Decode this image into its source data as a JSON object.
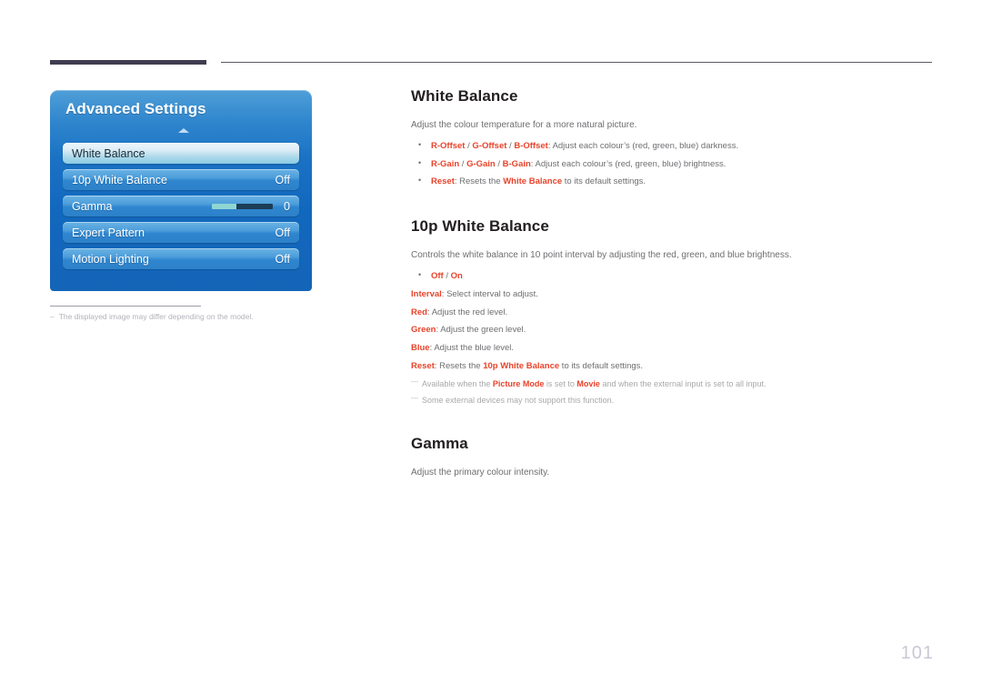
{
  "page": {
    "number": "101",
    "accent_color": "#e8432b",
    "body_color": "#6d6e71",
    "heading_color": "#231f20",
    "note_color": "#a7a9ac"
  },
  "osd": {
    "title": "Advanced Settings",
    "scroll_indicator": "up-arrow",
    "rows": [
      {
        "label": "White Balance",
        "value": "",
        "selected": true,
        "type": "item"
      },
      {
        "label": "10p White Balance",
        "value": "Off",
        "selected": false,
        "type": "item"
      },
      {
        "label": "Gamma",
        "value": "0",
        "selected": false,
        "type": "slider",
        "fill_percent": 40
      },
      {
        "label": "Expert Pattern",
        "value": "Off",
        "selected": false,
        "type": "item"
      },
      {
        "label": "Motion Lighting",
        "value": "Off",
        "selected": false,
        "type": "item"
      }
    ]
  },
  "left_note": {
    "dash": "–",
    "text": "The displayed image may differ depending on the model."
  },
  "sections": [
    {
      "title": "White Balance",
      "lead": "Adjust the colour temperature for a more natural picture.",
      "bullets": [
        {
          "parts": [
            {
              "t": "R-Offset",
              "s": "acc"
            },
            {
              "t": " / ",
              "s": "sep"
            },
            {
              "t": "G-Offset",
              "s": "acc"
            },
            {
              "t": " / ",
              "s": "sep"
            },
            {
              "t": "B-Offset",
              "s": "acc"
            },
            {
              "t": ": Adjust each colour’s (red, green, blue) darkness.",
              "s": "plain"
            }
          ]
        },
        {
          "parts": [
            {
              "t": "R-Gain",
              "s": "acc"
            },
            {
              "t": " / ",
              "s": "sep"
            },
            {
              "t": "G-Gain",
              "s": "acc"
            },
            {
              "t": " / ",
              "s": "sep"
            },
            {
              "t": "B-Gain",
              "s": "acc"
            },
            {
              "t": ": Adjust each colour’s (red, green, blue) brightness.",
              "s": "plain"
            }
          ]
        },
        {
          "parts": [
            {
              "t": "Reset",
              "s": "acc"
            },
            {
              "t": ": Resets the ",
              "s": "plain"
            },
            {
              "t": "White Balance",
              "s": "acc"
            },
            {
              "t": " to its default settings.",
              "s": "plain"
            }
          ]
        }
      ],
      "deflines": [],
      "notes": []
    },
    {
      "title": "10p White Balance",
      "lead": "Controls the white balance in 10 point interval by adjusting the red, green, and blue brightness.",
      "bullets": [
        {
          "parts": [
            {
              "t": "Off",
              "s": "acc"
            },
            {
              "t": " / ",
              "s": "sep"
            },
            {
              "t": "On",
              "s": "acc"
            }
          ]
        }
      ],
      "deflines": [
        {
          "parts": [
            {
              "t": "Interval",
              "s": "acc"
            },
            {
              "t": ": Select interval to adjust.",
              "s": "plain"
            }
          ]
        },
        {
          "parts": [
            {
              "t": "Red",
              "s": "acc"
            },
            {
              "t": ": Adjust the red level.",
              "s": "plain"
            }
          ]
        },
        {
          "parts": [
            {
              "t": "Green",
              "s": "acc"
            },
            {
              "t": ": Adjust the green level.",
              "s": "plain"
            }
          ]
        },
        {
          "parts": [
            {
              "t": "Blue",
              "s": "acc"
            },
            {
              "t": ": Adjust the blue level.",
              "s": "plain"
            }
          ]
        },
        {
          "parts": [
            {
              "t": "Reset",
              "s": "acc"
            },
            {
              "t": ": Resets the ",
              "s": "plain"
            },
            {
              "t": "10p White Balance",
              "s": "acc"
            },
            {
              "t": " to its default settings.",
              "s": "plain"
            }
          ]
        }
      ],
      "notes": [
        {
          "parts": [
            {
              "t": "Available when the ",
              "s": "plain"
            },
            {
              "t": "Picture Mode",
              "s": "acc"
            },
            {
              "t": " is set to ",
              "s": "plain"
            },
            {
              "t": "Movie",
              "s": "acc"
            },
            {
              "t": " and when the external input is set to all input.",
              "s": "plain"
            }
          ]
        },
        {
          "parts": [
            {
              "t": "Some external devices may not support this function.",
              "s": "plain"
            }
          ]
        }
      ]
    },
    {
      "title": "Gamma",
      "lead": "Adjust the primary colour intensity.",
      "bullets": [],
      "deflines": [],
      "notes": []
    }
  ]
}
